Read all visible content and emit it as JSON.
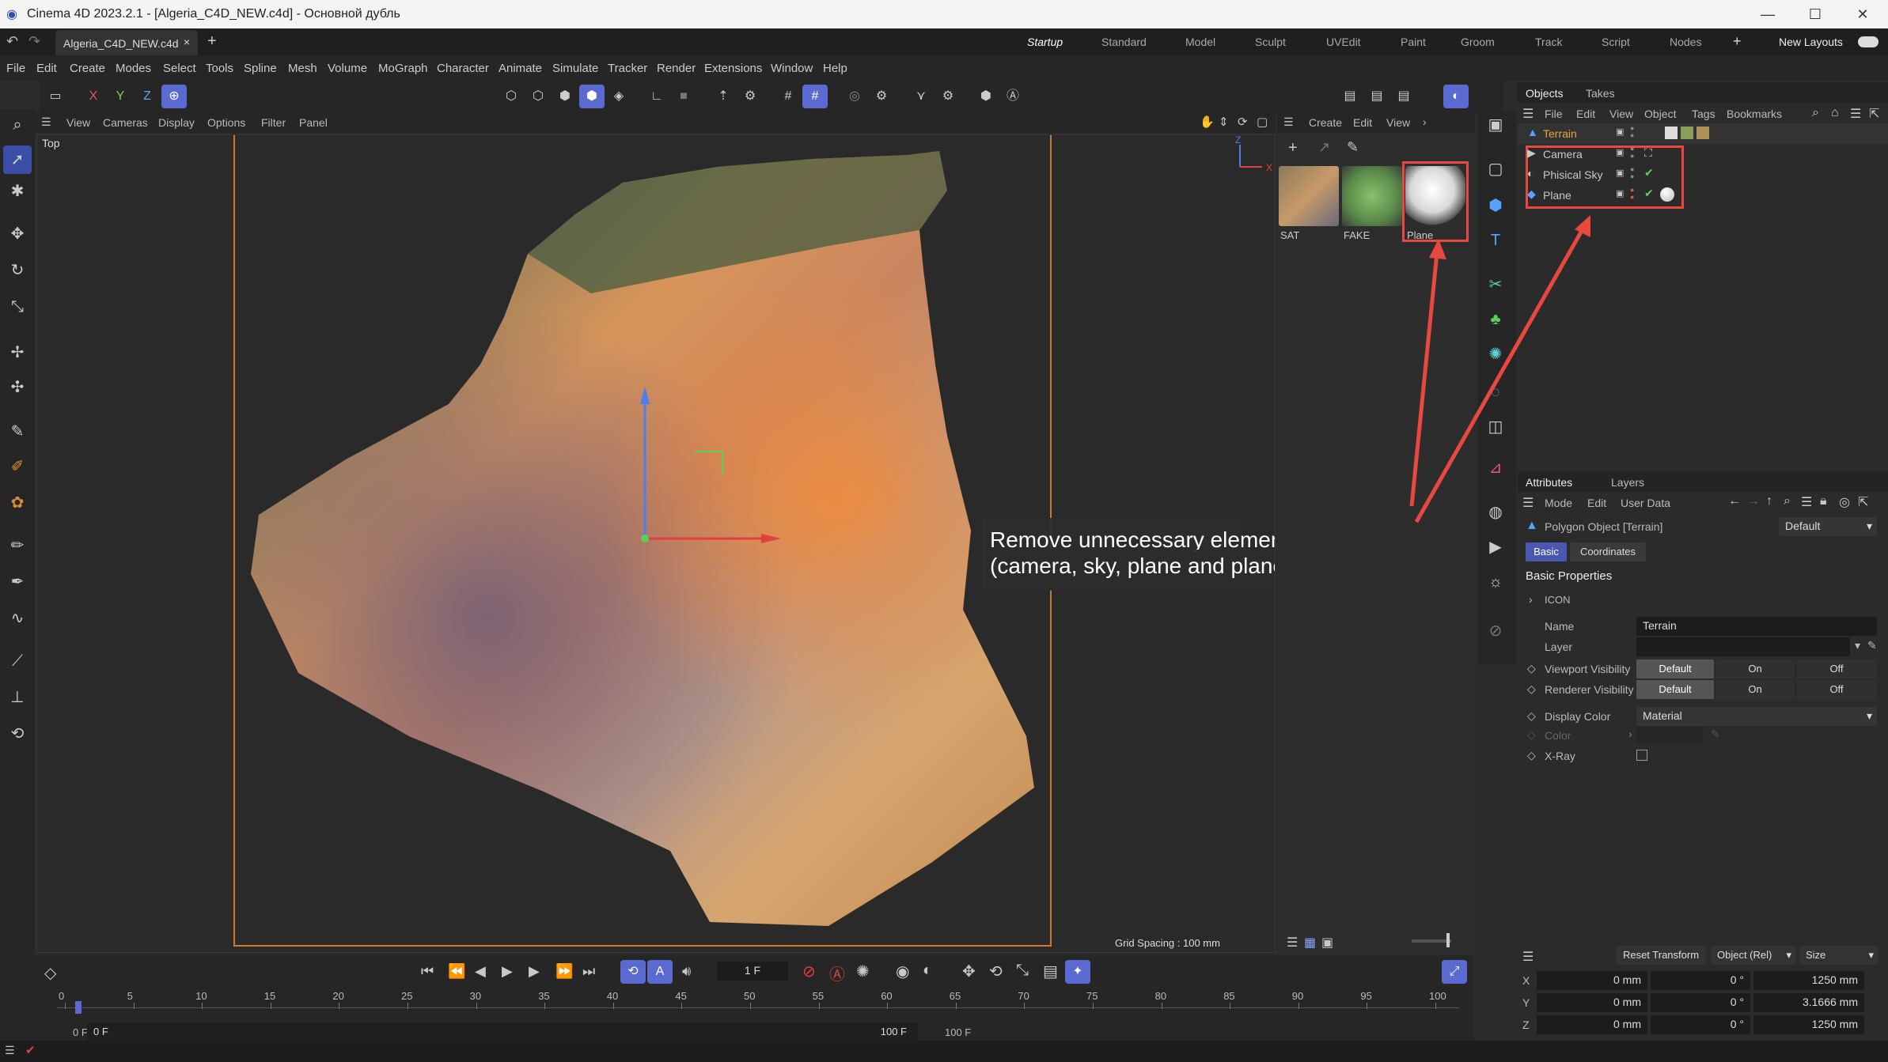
{
  "window": {
    "title": "Cinema 4D 2023.2.1 - [Algeria_C4D_NEW.c4d] - Основной дубль",
    "minimize": "—",
    "maximize": "☐",
    "close": "✕"
  },
  "tabs": {
    "doc_tab": "Algeria_C4D_NEW.c4d",
    "close": "×",
    "add": "+"
  },
  "layouts": {
    "items": [
      "Startup",
      "Standard",
      "Model",
      "Sculpt",
      "UVEdit",
      "Paint",
      "Groom",
      "Track",
      "Script",
      "Nodes"
    ],
    "add": "+",
    "new_layouts": "New Layouts"
  },
  "menu": {
    "items": [
      "File",
      "Edit",
      "Create",
      "Modes",
      "Select",
      "Tools",
      "Spline",
      "Mesh",
      "Volume",
      "MoGraph",
      "Character",
      "Animate",
      "Simulate",
      "Tracker",
      "Render",
      "Extensions",
      "Window",
      "Help"
    ]
  },
  "axes": {
    "x": "X",
    "y": "Y",
    "z": "Z"
  },
  "viewport": {
    "menu": [
      "View",
      "Cameras",
      "Display",
      "Options",
      "Filter",
      "Panel"
    ],
    "label": "Top",
    "grid_spacing": "Grid Spacing : 100 mm",
    "annotation_line1": "Remove unnecessary elements",
    "annotation_line2": "(camera, sky, plane and plane material)"
  },
  "materials": {
    "menu": [
      "Create",
      "Edit",
      "View"
    ],
    "items": [
      {
        "label": "SAT"
      },
      {
        "label": "FAKE"
      },
      {
        "label": "Plane"
      }
    ]
  },
  "objects_panel": {
    "tabs": [
      "Objects",
      "Takes"
    ],
    "menu": [
      "File",
      "Edit",
      "View",
      "Object",
      "Tags",
      "Bookmarks"
    ],
    "items": [
      {
        "name": "Terrain",
        "color": "#e8a33c"
      },
      {
        "name": "Camera",
        "color": "#d0d0d0"
      },
      {
        "name": "Phisical Sky",
        "color": "#d0d0d0"
      },
      {
        "name": "Plane",
        "color": "#d0d0d0"
      }
    ]
  },
  "attributes": {
    "tabs": [
      "Attributes",
      "Layers"
    ],
    "menu": [
      "Mode",
      "Edit",
      "User Data"
    ],
    "object_type": "Polygon Object [Terrain]",
    "preset": "Default",
    "subtabs": [
      "Basic",
      "Coordinates"
    ],
    "section": "Basic Properties",
    "icon_group": "ICON",
    "fields": {
      "name_label": "Name",
      "name_value": "Terrain",
      "layer_label": "Layer",
      "viewport_vis_label": "Viewport Visibility",
      "renderer_vis_label": "Renderer Visibility",
      "vis_options": [
        "Default",
        "On",
        "Off"
      ],
      "display_color_label": "Display Color",
      "display_color_value": "Material",
      "color_label": "Color",
      "xray_label": "X-Ray"
    }
  },
  "coords": {
    "reset": "Reset Transform",
    "mode": "Object (Rel)",
    "size": "Size",
    "rows": [
      {
        "axis": "X",
        "pos": "0 mm",
        "rot": "0 °",
        "size": "1250 mm"
      },
      {
        "axis": "Y",
        "pos": "0 mm",
        "rot": "0 °",
        "size": "3.1666 mm"
      },
      {
        "axis": "Z",
        "pos": "0 mm",
        "rot": "0 °",
        "size": "1250 mm"
      }
    ]
  },
  "timeline": {
    "frame": "1 F",
    "ticks": [
      "0",
      "5",
      "10",
      "15",
      "20",
      "25",
      "30",
      "35",
      "40",
      "45",
      "50",
      "55",
      "60",
      "65",
      "70",
      "75",
      "80",
      "85",
      "90",
      "95",
      "100"
    ],
    "start_a": "0 F",
    "start_b": "0 F",
    "end_a": "100 F",
    "end_b": "100 F",
    "current_frame": 1,
    "max_frame": 100
  },
  "colors": {
    "accent": "#5a6ad0",
    "annotation_red": "#e8483f",
    "terrain_label": "#e8a33c"
  }
}
